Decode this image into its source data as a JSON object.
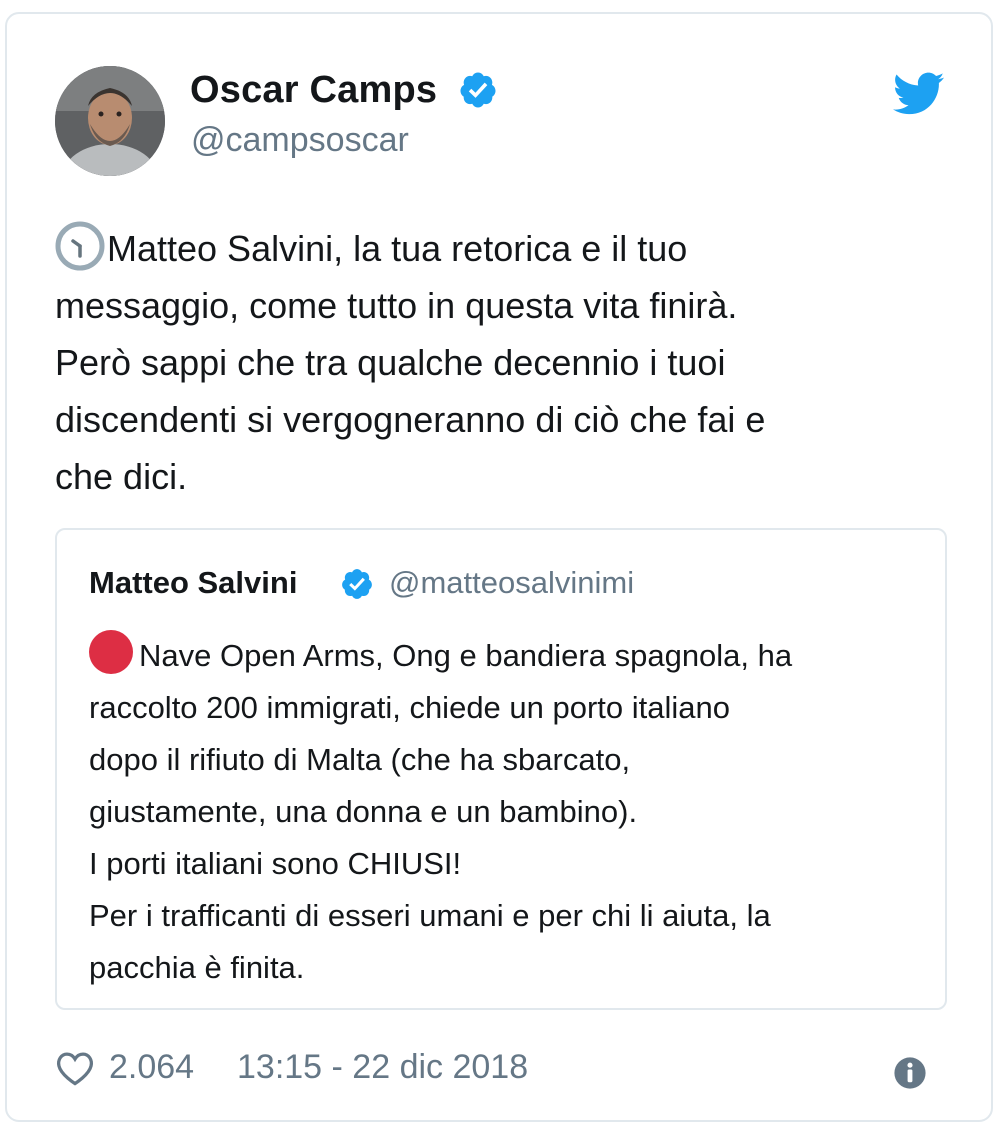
{
  "tweet": {
    "author": {
      "name": "Oscar Camps",
      "handle": "@campsoscar",
      "verified": true
    },
    "text_lines": [
      "Matteo Salvini, la tua retorica e il tuo",
      "messaggio, come tutto in questa vita finirà.",
      "Però sappi che tra qualche decennio i tuoi",
      "discendenti si vergogneranno di ciò che fai e",
      "che dici."
    ],
    "leading_icon": "clock-one-oclock-emoji",
    "likes": "2.064",
    "timestamp": "13:15 - 22 dic 2018"
  },
  "quoted": {
    "author": {
      "name": "Matteo Salvini",
      "handle": "@matteosalvinimi",
      "verified": true
    },
    "leading_icon": "red-circle-emoji",
    "text_lines": [
      "Nave Open Arms, Ong e bandiera spagnola, ha",
      "raccolto 200 immigrati, chiede un porto italiano",
      "dopo il rifiuto di Malta (che ha sbarcato,",
      "giustamente, una donna e un bambino).",
      "I porti italiani sono CHIUSI!",
      "Per i trafficanti di esseri umani e per chi li aiuta, la",
      "pacchia è finita."
    ]
  },
  "icons": {
    "brand": "twitter-bird-icon",
    "like": "heart-icon",
    "info": "info-icon",
    "verified": "verified-badge-icon"
  },
  "colors": {
    "twitter_blue": "#1da1f2",
    "text": "#14171a",
    "muted": "#657786",
    "border": "#e1e8ed",
    "red_dot": "#dd2e44"
  }
}
